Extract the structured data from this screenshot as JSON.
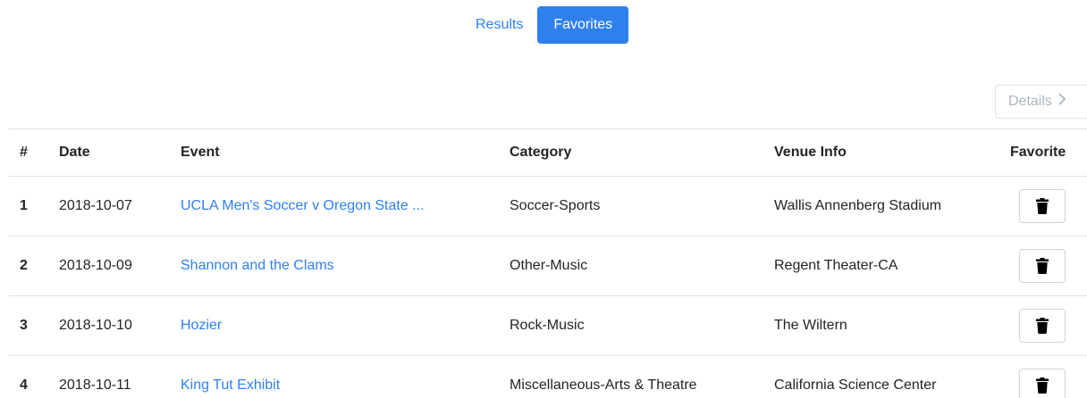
{
  "tabs": [
    {
      "label": "Results",
      "active": false
    },
    {
      "label": "Favorites",
      "active": true
    }
  ],
  "details_button": {
    "label": "Details",
    "icon": "chevron-right-icon",
    "disabled": true
  },
  "table": {
    "headers": [
      "#",
      "Date",
      "Event",
      "Category",
      "Venue Info",
      "Favorite"
    ],
    "rows": [
      {
        "num": "1",
        "date": "2018-10-07",
        "event": "UCLA Men's Soccer v Oregon State ...",
        "category": "Soccer-Sports",
        "venue": "Wallis Annenberg Stadium"
      },
      {
        "num": "2",
        "date": "2018-10-09",
        "event": "Shannon and the Clams",
        "category": "Other-Music",
        "venue": "Regent Theater-CA"
      },
      {
        "num": "3",
        "date": "2018-10-10",
        "event": "Hozier",
        "category": "Rock-Music",
        "venue": "The Wiltern"
      },
      {
        "num": "4",
        "date": "2018-10-11",
        "event": "King Tut Exhibit",
        "category": "Miscellaneous-Arts & Theatre",
        "venue": "California Science Center"
      }
    ],
    "row_action_icon": "trash-icon"
  },
  "colors": {
    "accent": "#2f80ed",
    "border": "#dee2e6",
    "disabled_text": "#adb5bd"
  }
}
